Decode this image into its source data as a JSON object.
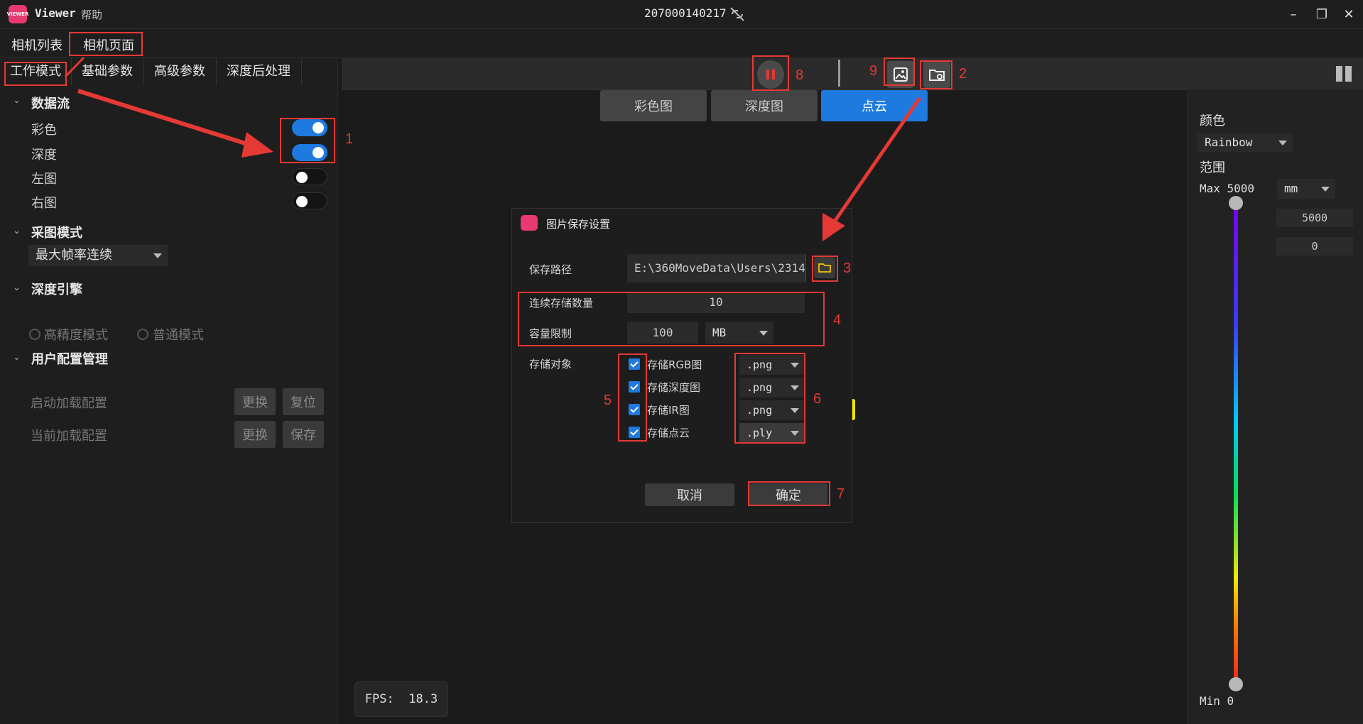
{
  "titlebar": {
    "logo_text": "VIEWER",
    "app_name": "Viewer",
    "help": "帮助",
    "device_id": "207000140217",
    "icons": {
      "link": "link-off-icon",
      "minimize": "minimize-icon",
      "restore": "restore-icon",
      "close": "close-icon"
    }
  },
  "top_tabs": [
    "相机列表",
    "相机页面"
  ],
  "sub_tabs": [
    "工作模式",
    "基础参数",
    "高级参数",
    "深度后处理"
  ],
  "data_stream": {
    "title": "数据流",
    "items": [
      {
        "label": "彩色",
        "on": true
      },
      {
        "label": "深度",
        "on": true
      },
      {
        "label": "左图",
        "on": false
      },
      {
        "label": "右图",
        "on": false
      }
    ]
  },
  "capture_mode": {
    "title": "采图模式",
    "value": "最大帧率连续"
  },
  "depth_engine": {
    "title": "深度引擎",
    "options": [
      "高精度模式",
      "普通模式"
    ]
  },
  "user_config": {
    "title": "用户配置管理",
    "rows": [
      {
        "label": "启动加载配置",
        "buttons": [
          "更换",
          "复位"
        ]
      },
      {
        "label": "当前加载配置",
        "buttons": [
          "更换",
          "保存"
        ]
      }
    ]
  },
  "view_tabs": [
    "彩色图",
    "深度图",
    "点云"
  ],
  "active_view_tab": 2,
  "fps": {
    "label": "FPS:",
    "value": "18.3"
  },
  "dialog": {
    "title": "图片保存设置",
    "save_path_label": "保存路径",
    "save_path_value": "E:\\360MoveData\\Users\\2314\\",
    "continuous_label": "连续存储数量",
    "continuous_value": "10",
    "capacity_label": "容量限制",
    "capacity_value": "100",
    "capacity_unit": "MB",
    "objects_label": "存储对象",
    "objects": [
      {
        "label": "存储RGB图",
        "format": ".png"
      },
      {
        "label": "存储深度图",
        "format": ".png"
      },
      {
        "label": "存储IR图",
        "format": ".png"
      },
      {
        "label": "存储点云",
        "format": ".ply"
      }
    ],
    "cancel": "取消",
    "ok": "确定"
  },
  "right_panel": {
    "color_label": "颜色",
    "color_value": "Rainbow",
    "range_label": "范围",
    "max_label": "Max 5000",
    "unit": "mm",
    "max_input": "5000",
    "min_input": "0",
    "min_label": "Min 0"
  },
  "annotations": [
    "1",
    "2",
    "3",
    "4",
    "5",
    "6",
    "7",
    "8",
    "9"
  ],
  "colors": {
    "accent": "#1f7ae0",
    "annotation": "#e53935",
    "logo": "#e83a70"
  }
}
